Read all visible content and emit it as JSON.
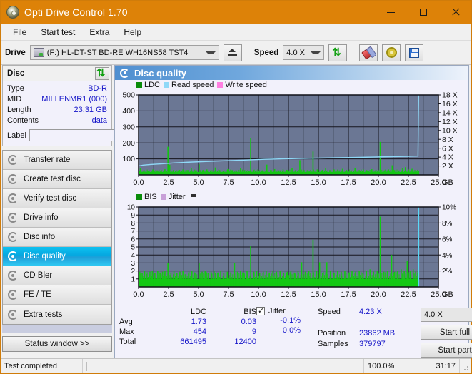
{
  "window": {
    "title": "Opti Drive Control 1.70",
    "icon": "disc-icon",
    "minimize": "−",
    "maximize": "□",
    "close": "✕"
  },
  "menu": [
    "File",
    "Start test",
    "Extra",
    "Help"
  ],
  "toolbar": {
    "drive_label": "Drive",
    "drive_value": "(F:)  HL-DT-ST BD-RE  WH16NS58 TST4",
    "eject_title": "eject-button",
    "speed_label": "Speed",
    "speed_value": "4.0 X",
    "refresh_title": "refresh-button",
    "erase_title": "erase-button",
    "settings_title": "settings-button",
    "save_title": "save-button"
  },
  "disc_panel": {
    "title": "Disc",
    "refresh_icon": "refresh-icon",
    "rows": [
      {
        "key": "Type",
        "value": "BD-R"
      },
      {
        "key": "MID",
        "value": "MILLENMR1 (000)"
      },
      {
        "key": "Length",
        "value": "23.31 GB"
      },
      {
        "key": "Contents",
        "value": "data"
      }
    ],
    "label_key": "Label",
    "label_value": "",
    "label_placeholder": ""
  },
  "nav": {
    "items": [
      {
        "label": "Transfer rate",
        "active": false
      },
      {
        "label": "Create test disc",
        "active": false
      },
      {
        "label": "Verify test disc",
        "active": false
      },
      {
        "label": "Drive info",
        "active": false
      },
      {
        "label": "Disc info",
        "active": false
      },
      {
        "label": "Disc quality",
        "active": true
      },
      {
        "label": "CD Bler",
        "active": false
      },
      {
        "label": "FE / TE",
        "active": false
      },
      {
        "label": "Extra tests",
        "active": false
      }
    ],
    "status_window": "Status window >>"
  },
  "quality": {
    "header": "Disc quality",
    "header_icon": "disc-quality-icon"
  },
  "stats": {
    "col_headers": [
      "LDC",
      "BIS"
    ],
    "rows": [
      {
        "label": "Avg",
        "ldc": "1.73",
        "bis": "0.03"
      },
      {
        "label": "Max",
        "ldc": "454",
        "bis": "9"
      },
      {
        "label": "Total",
        "ldc": "661495",
        "bis": "12400"
      }
    ],
    "jitter_label": "Jitter",
    "jitter_checked": true,
    "jitter_values": [
      "-0.1%",
      "0.0%"
    ],
    "speed_label": "Speed",
    "speed_value": "4.23 X",
    "position_label": "Position",
    "position_value": "23862 MB",
    "samples_label": "Samples",
    "samples_value": "379797",
    "speed_select": "4.0 X",
    "start_full": "Start full",
    "start_part": "Start part"
  },
  "statusbar": {
    "message": "Test completed",
    "progress_percent": 100.0,
    "progress_text": "100.0%",
    "elapsed": "31:17"
  },
  "colors": {
    "title_bar": "#dd8208",
    "plot_bg": "#6b7794",
    "ldc_green": "#14c814",
    "read_speed": "#8fd8f7",
    "write_speed": "#ff7fe0",
    "bis_green": "#14c814",
    "jitter": "#c8a0d8",
    "value_blue": "#1414c8",
    "accent_blue": "#05a8e0",
    "progress_green": "#19b219"
  },
  "chart_data": [
    {
      "type": "line",
      "name": "ldc-chart",
      "title": "",
      "xlabel": "GB",
      "ylabel": "",
      "xlim": [
        0,
        25
      ],
      "xticks": [
        0.0,
        2.5,
        5.0,
        7.5,
        10.0,
        12.5,
        15.0,
        17.5,
        20.0,
        22.5,
        25.0
      ],
      "xticklabels": [
        "0.0",
        "2.5",
        "5.0",
        "7.5",
        "10.0",
        "12.5",
        "15.0",
        "17.5",
        "20.0",
        "22.5",
        "25.0"
      ],
      "x_unit_label": "GB",
      "ylim": [
        0,
        500
      ],
      "yticks": [
        100,
        200,
        300,
        400,
        500
      ],
      "yticklabels": [
        "100",
        "200",
        "300",
        "400",
        "500"
      ],
      "y2lim": [
        0,
        18
      ],
      "y2ticks": [
        2,
        4,
        6,
        8,
        10,
        12,
        14,
        16,
        18
      ],
      "y2ticklabels": [
        "2 X",
        "4 X",
        "6 X",
        "8 X",
        "10 X",
        "12 X",
        "14 X",
        "16 X",
        "18 X"
      ],
      "grid": true,
      "legend": [
        "LDC",
        "Read speed",
        "Write speed"
      ],
      "legend_position": "top-left",
      "series": [
        {
          "name": "LDC",
          "kind": "impulse",
          "color": "#14c814",
          "baseline": 18,
          "peaks": [
            [
              0.15,
              42
            ],
            [
              0.45,
              30
            ],
            [
              0.8,
              26
            ],
            [
              1.2,
              34
            ],
            [
              1.55,
              28
            ],
            [
              1.9,
              30
            ],
            [
              2.2,
              36
            ],
            [
              2.45,
              176
            ],
            [
              2.6,
              62
            ],
            [
              2.9,
              30
            ],
            [
              3.3,
              28
            ],
            [
              3.7,
              34
            ],
            [
              4.05,
              30
            ],
            [
              4.4,
              44
            ],
            [
              4.75,
              28
            ],
            [
              5.05,
              66
            ],
            [
              5.35,
              30
            ],
            [
              5.7,
              34
            ],
            [
              6.0,
              28
            ],
            [
              6.4,
              46
            ],
            [
              6.75,
              30
            ],
            [
              7.1,
              26
            ],
            [
              7.45,
              36
            ],
            [
              7.8,
              30
            ],
            [
              8.15,
              28
            ],
            [
              8.5,
              40
            ],
            [
              8.85,
              30
            ],
            [
              9.2,
              26
            ],
            [
              9.35,
              228
            ],
            [
              9.6,
              30
            ],
            [
              9.95,
              34
            ],
            [
              10.3,
              28
            ],
            [
              10.7,
              64
            ],
            [
              11.0,
              30
            ],
            [
              11.35,
              36
            ],
            [
              11.7,
              28
            ],
            [
              12.05,
              34
            ],
            [
              12.4,
              30
            ],
            [
              12.8,
              44
            ],
            [
              13.1,
              28
            ],
            [
              13.45,
              92
            ],
            [
              13.8,
              30
            ],
            [
              14.15,
              26
            ],
            [
              14.55,
              146
            ],
            [
              14.9,
              34
            ],
            [
              15.25,
              28
            ],
            [
              15.6,
              40
            ],
            [
              15.95,
              30
            ],
            [
              16.3,
              34
            ],
            [
              16.65,
              28
            ],
            [
              17.0,
              38
            ],
            [
              17.35,
              30
            ],
            [
              17.7,
              26
            ],
            [
              18.05,
              42
            ],
            [
              18.4,
              30
            ],
            [
              18.75,
              34
            ],
            [
              19.1,
              28
            ],
            [
              19.45,
              36
            ],
            [
              19.8,
              30
            ],
            [
              20.15,
              206
            ],
            [
              20.5,
              28
            ],
            [
              20.85,
              34
            ],
            [
              21.15,
              60
            ],
            [
              21.35,
              30
            ],
            [
              21.7,
              26
            ],
            [
              22.0,
              40
            ],
            [
              22.25,
              48
            ],
            [
              22.5,
              34
            ],
            [
              22.8,
              38
            ],
            [
              23.1,
              30
            ],
            [
              23.35,
              26
            ]
          ]
        },
        {
          "name": "Read speed",
          "kind": "line",
          "color": "#8fd8f7",
          "points": [
            [
              0.0,
              2.0
            ],
            [
              0.4,
              2.2
            ],
            [
              1.0,
              2.35
            ],
            [
              2.0,
              2.5
            ],
            [
              3.0,
              2.7
            ],
            [
              4.5,
              2.9
            ],
            [
              6.0,
              3.05
            ],
            [
              7.5,
              3.2
            ],
            [
              9.0,
              3.35
            ],
            [
              10.5,
              3.5
            ],
            [
              12.0,
              3.6
            ],
            [
              13.5,
              3.7
            ],
            [
              15.0,
              3.78
            ],
            [
              16.5,
              3.85
            ],
            [
              18.0,
              3.92
            ],
            [
              19.5,
              4.0
            ],
            [
              21.0,
              4.1
            ],
            [
              22.5,
              4.18
            ],
            [
              23.3,
              4.22
            ],
            [
              23.35,
              18.0
            ]
          ]
        },
        {
          "name": "Write speed",
          "kind": "line",
          "color": "#ff7fe0",
          "points": []
        }
      ]
    },
    {
      "type": "line",
      "name": "bis-chart",
      "title": "",
      "xlabel": "GB",
      "ylabel": "",
      "xlim": [
        0,
        25
      ],
      "xticks": [
        0.0,
        2.5,
        5.0,
        7.5,
        10.0,
        12.5,
        15.0,
        17.5,
        20.0,
        22.5,
        25.0
      ],
      "xticklabels": [
        "0.0",
        "2.5",
        "5.0",
        "7.5",
        "10.0",
        "12.5",
        "15.0",
        "17.5",
        "20.0",
        "22.5",
        "25.0"
      ],
      "x_unit_label": "GB",
      "ylim": [
        0,
        10
      ],
      "yticks": [
        1,
        2,
        3,
        4,
        5,
        6,
        7,
        8,
        9,
        10
      ],
      "yticklabels": [
        "1",
        "2",
        "3",
        "4",
        "5",
        "6",
        "7",
        "8",
        "9",
        "10"
      ],
      "y2lim": [
        0,
        10
      ],
      "y2ticks": [
        2,
        4,
        6,
        8,
        10
      ],
      "y2ticklabels": [
        "2%",
        "4%",
        "6%",
        "8%",
        "10%"
      ],
      "grid": true,
      "legend": [
        "BIS",
        "Jitter"
      ],
      "legend_position": "top-left",
      "series": [
        {
          "name": "BIS",
          "kind": "impulse",
          "color": "#14c814",
          "baseline": 1.0,
          "peaks": [
            [
              0.1,
              1.9
            ],
            [
              0.3,
              1.7
            ],
            [
              0.5,
              2.0
            ],
            [
              0.7,
              1.6
            ],
            [
              0.95,
              1.9
            ],
            [
              1.15,
              2.0
            ],
            [
              1.35,
              1.7
            ],
            [
              1.6,
              2.0
            ],
            [
              1.8,
              1.8
            ],
            [
              2.0,
              1.9
            ],
            [
              2.2,
              2.0
            ],
            [
              2.45,
              3.0
            ],
            [
              2.7,
              1.8
            ],
            [
              2.95,
              2.0
            ],
            [
              3.2,
              1.7
            ],
            [
              3.45,
              1.9
            ],
            [
              3.7,
              2.0
            ],
            [
              3.95,
              1.6
            ],
            [
              4.2,
              1.9
            ],
            [
              4.45,
              2.0
            ],
            [
              4.7,
              1.7
            ],
            [
              5.05,
              3.0
            ],
            [
              5.3,
              1.9
            ],
            [
              5.55,
              2.0
            ],
            [
              5.8,
              1.7
            ],
            [
              6.05,
              1.9
            ],
            [
              6.3,
              2.0
            ],
            [
              6.6,
              1.8
            ],
            [
              6.85,
              2.0
            ],
            [
              7.1,
              1.7
            ],
            [
              7.4,
              1.9
            ],
            [
              7.7,
              1.8
            ],
            [
              8.0,
              3.0
            ],
            [
              8.25,
              1.9
            ],
            [
              8.5,
              2.0
            ],
            [
              8.8,
              1.8
            ],
            [
              9.05,
              2.0
            ],
            [
              9.35,
              5.1
            ],
            [
              9.6,
              1.9
            ],
            [
              9.85,
              2.0
            ],
            [
              10.1,
              1.7
            ],
            [
              10.4,
              1.9
            ],
            [
              10.65,
              2.0
            ],
            [
              10.9,
              1.8
            ],
            [
              11.2,
              2.0
            ],
            [
              11.5,
              1.9
            ],
            [
              11.8,
              2.0
            ],
            [
              12.1,
              1.8
            ],
            [
              12.4,
              1.9
            ],
            [
              12.7,
              2.0
            ],
            [
              13.0,
              1.8
            ],
            [
              13.3,
              2.0
            ],
            [
              13.6,
              3.1
            ],
            [
              13.9,
              1.9
            ],
            [
              14.2,
              2.0
            ],
            [
              14.55,
              5.9
            ],
            [
              14.85,
              2.0
            ],
            [
              15.1,
              3.1
            ],
            [
              15.4,
              1.9
            ],
            [
              15.7,
              3.1
            ],
            [
              16.0,
              2.0
            ],
            [
              16.3,
              1.8
            ],
            [
              16.6,
              2.0
            ],
            [
              16.9,
              1.9
            ],
            [
              17.2,
              2.0
            ],
            [
              17.5,
              1.8
            ],
            [
              17.8,
              2.0
            ],
            [
              18.1,
              1.9
            ],
            [
              18.4,
              2.0
            ],
            [
              18.7,
              1.8
            ],
            [
              19.0,
              2.0
            ],
            [
              19.3,
              2.2
            ],
            [
              19.6,
              1.9
            ],
            [
              19.9,
              2.0
            ],
            [
              20.15,
              8.8
            ],
            [
              20.45,
              1.9
            ],
            [
              20.75,
              2.0
            ],
            [
              21.1,
              4.0
            ],
            [
              21.35,
              1.9
            ],
            [
              21.6,
              2.0
            ],
            [
              21.9,
              2.2
            ],
            [
              22.15,
              2.0
            ],
            [
              22.4,
              3.3
            ],
            [
              22.65,
              2.0
            ],
            [
              22.9,
              2.2
            ],
            [
              23.1,
              1.9
            ],
            [
              23.3,
              2.0
            ]
          ]
        },
        {
          "name": "Jitter",
          "kind": "line",
          "color": "#c8a0d8",
          "points": []
        },
        {
          "name": "Marker",
          "kind": "cursor",
          "color": "#59d8f8",
          "x": 23.35
        }
      ]
    }
  ]
}
